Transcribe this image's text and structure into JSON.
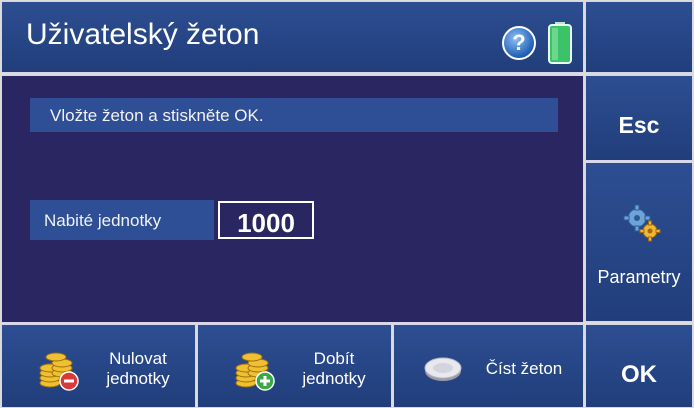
{
  "title_bar": {
    "title": "Uživatelský žeton",
    "help_icon": "help-icon",
    "help_symbol": "?",
    "battery_icon": "battery-icon"
  },
  "main": {
    "message": "Vložte žeton a stiskněte OK.",
    "units_label": "Nabité jednotky",
    "units_value": "1000"
  },
  "side_buttons": {
    "esc": "Esc",
    "parameters": "Parametry",
    "ok": "OK"
  },
  "bottom_buttons": {
    "reset_line1": "Nulovat",
    "reset_line2": "jednotky",
    "charge_line1": "Dobít",
    "charge_line2": "jednotky",
    "read_token": "Číst žeton"
  },
  "colors": {
    "title_bar": "#2d4e92",
    "main_background": "#2a2661",
    "field_background": "#2e4f95",
    "text": "#ffffff"
  }
}
